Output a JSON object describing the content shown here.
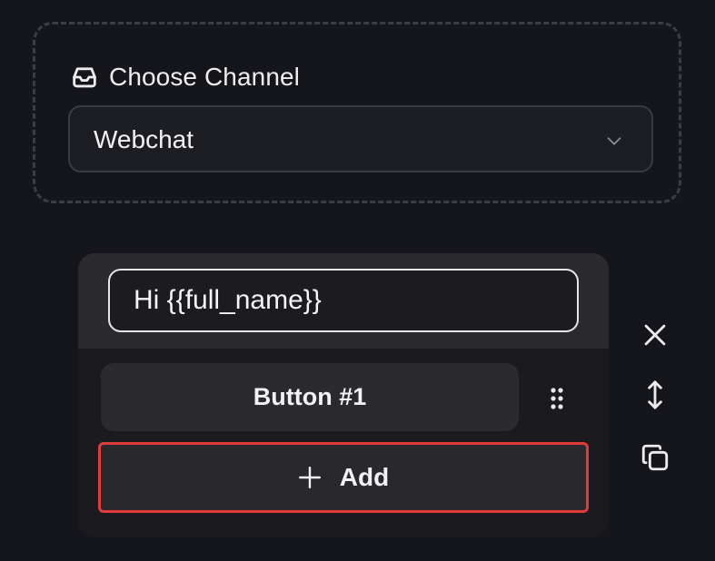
{
  "channel": {
    "label": "Choose Channel",
    "selected": "Webchat",
    "label_icon": "inbox-icon",
    "dropdown_icon": "chevron-down-icon"
  },
  "message": {
    "text": "Hi {{full_name}}",
    "buttons": [
      {
        "label": "Button #1"
      }
    ],
    "add_label": "Add",
    "drag_icon": "drag-handle-icon"
  },
  "actions": {
    "close_icon": "close-icon",
    "resize_icon": "vertical-resize-icon",
    "copy_icon": "copy-icon"
  },
  "colors": {
    "background": "#15151c",
    "highlight": "#e23b3b",
    "text": "#ededf0"
  }
}
